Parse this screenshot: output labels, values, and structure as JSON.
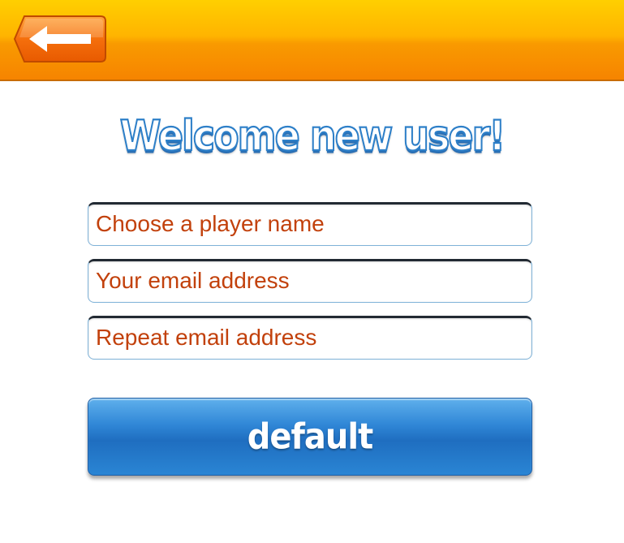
{
  "header": {
    "back_icon": "arrow-left-icon",
    "accent_color": "#f78f00"
  },
  "title": "Welcome new user!",
  "form": {
    "player_name": {
      "value": "",
      "placeholder": "Choose a player name"
    },
    "email": {
      "value": "",
      "placeholder": "Your email address"
    },
    "email_repeat": {
      "value": "",
      "placeholder": "Repeat email address"
    },
    "placeholder_color": "#c2410c"
  },
  "submit_button": {
    "label": "default",
    "color": "#2a7fd0"
  }
}
